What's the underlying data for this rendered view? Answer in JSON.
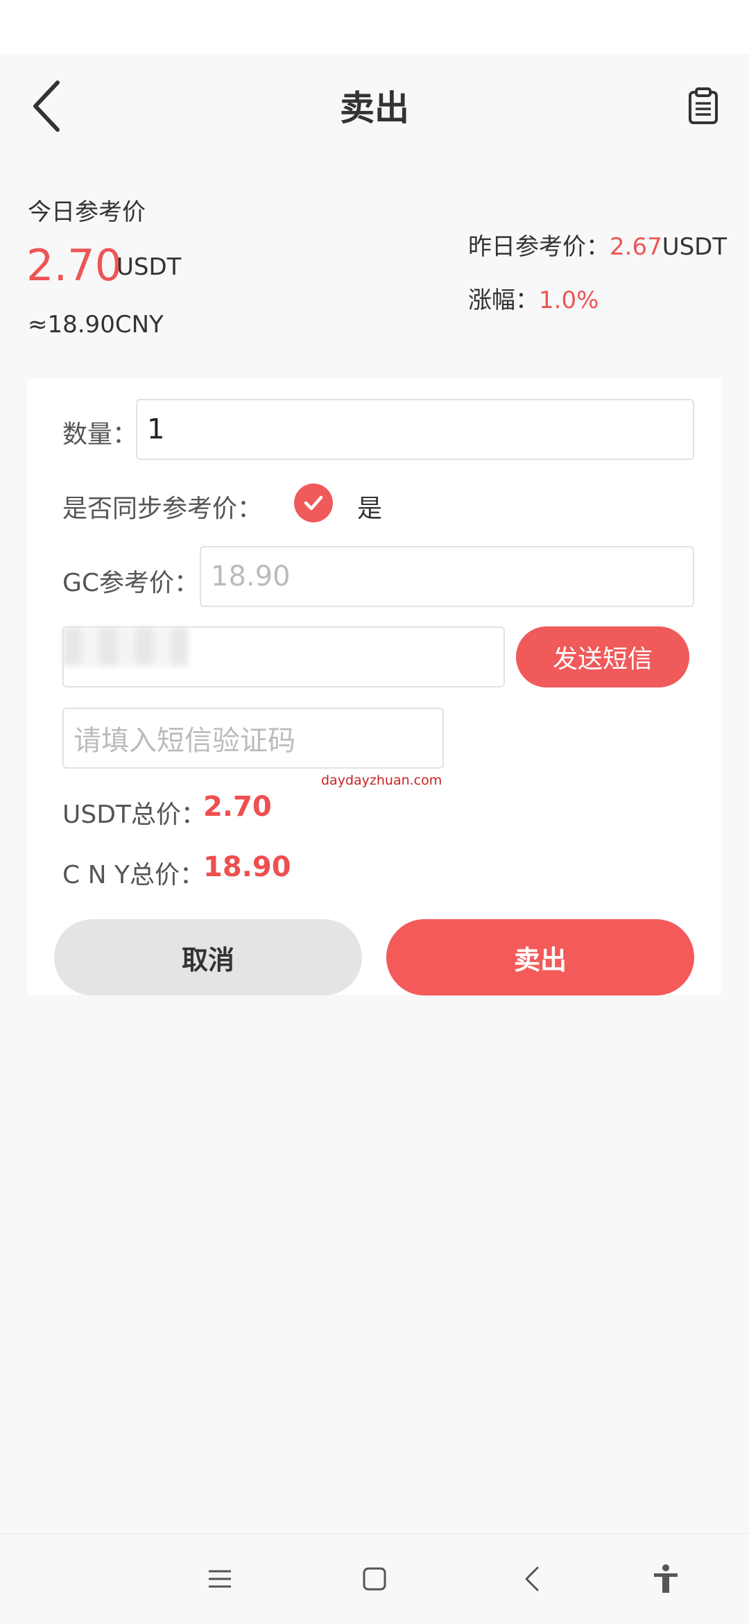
{
  "header": {
    "title": "卖出"
  },
  "price": {
    "today_label": "今日参考价",
    "today_value": "2.70",
    "today_unit": "USDT",
    "today_cny": "≈18.90CNY",
    "yesterday_label": "昨日参考价：",
    "yesterday_value": "2.67",
    "yesterday_unit": "USDT",
    "change_label": "涨幅：",
    "change_value": "1.0%"
  },
  "form": {
    "quantity_label": "数量：",
    "quantity_value": "1",
    "sync_label": "是否同步参考价：",
    "sync_option": "是",
    "sync_checked": true,
    "gc_label": "GC参考价：",
    "gc_placeholder": "18.90",
    "sms_button": "发送短信",
    "sms_placeholder": "请填入短信验证码",
    "usdt_total_label": "USDT总价：",
    "usdt_total_value": "2.70",
    "cny_total_label": "C N Y总价：",
    "cny_total_value": "18.90",
    "watermark": "daydayzhuan.com"
  },
  "actions": {
    "cancel": "取消",
    "sell": "卖出"
  },
  "icons": {
    "back": "chevron-left-icon",
    "record": "clipboard-icon",
    "check": "check-icon",
    "nav_menu": "menu-icon",
    "nav_home": "square-icon",
    "nav_back": "back-icon",
    "nav_accessibility": "accessibility-icon"
  },
  "colors": {
    "accent": "#f05a5a",
    "price_red": "#ee5555"
  }
}
